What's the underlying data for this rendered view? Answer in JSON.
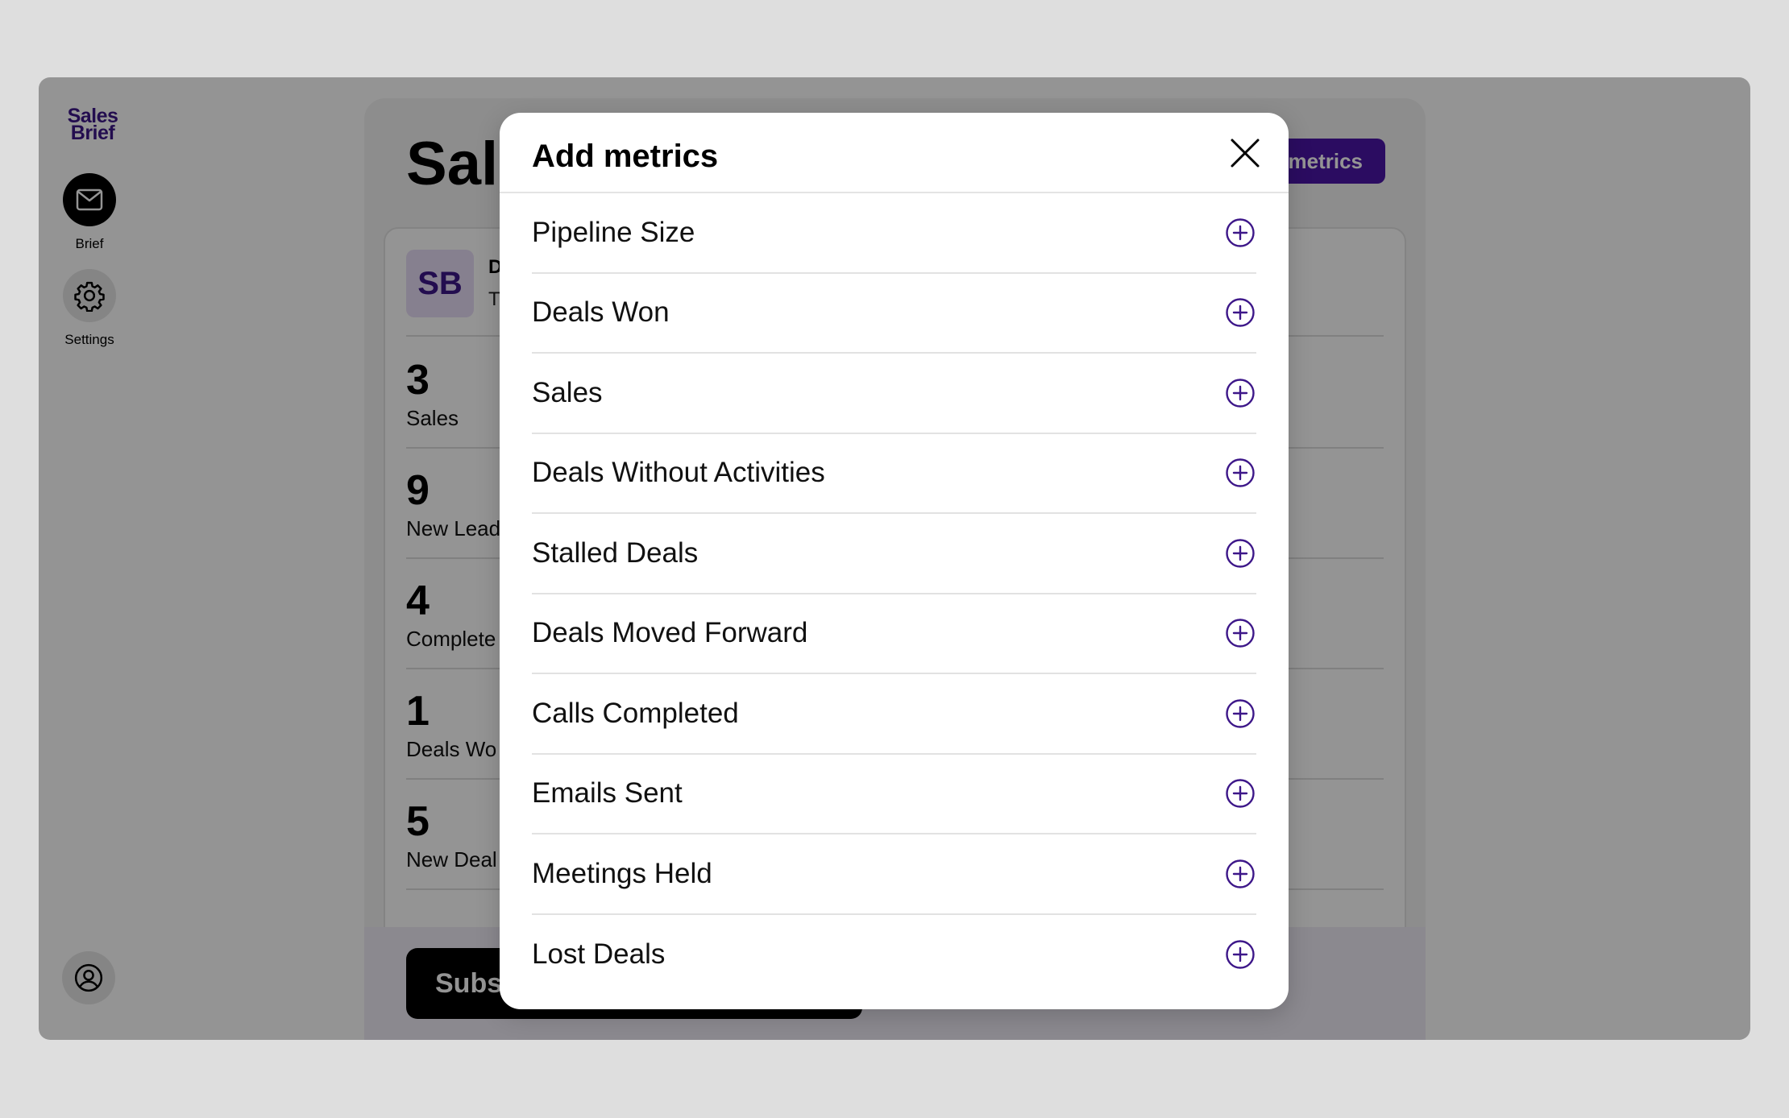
{
  "app": {
    "logo_line1": "Sales",
    "logo_line2": "Brief",
    "nav": {
      "brief_label": "Brief",
      "settings_label": "Settings"
    },
    "icons": {
      "brief": "mail-icon",
      "settings": "gear-icon",
      "profile": "user-circle-icon"
    }
  },
  "background": {
    "title": "Sal",
    "add_metrics_button": "metrics",
    "header": {
      "initials": "SB",
      "name": "D",
      "subtitle": "T"
    },
    "metrics": [
      {
        "value": "3",
        "label": "Sales"
      },
      {
        "value": "9",
        "label": "New Lead"
      },
      {
        "value": "4",
        "label": "Complete"
      },
      {
        "value": "1",
        "label": "Deals Wo"
      },
      {
        "value": "5",
        "label": "New Deal"
      }
    ],
    "subscribe_button": "Subs"
  },
  "modal": {
    "title": "Add metrics",
    "close_icon": "close-icon",
    "items": [
      {
        "label": "Pipeline Size"
      },
      {
        "label": "Deals Won"
      },
      {
        "label": "Sales"
      },
      {
        "label": "Deals Without Activities"
      },
      {
        "label": "Stalled Deals"
      },
      {
        "label": "Deals Moved Forward"
      },
      {
        "label": "Calls Completed"
      },
      {
        "label": "Emails Sent"
      },
      {
        "label": "Meetings Held"
      },
      {
        "label": "Lost Deals"
      }
    ]
  },
  "colors": {
    "brand": "#3d1789",
    "accent_button": "#4b16a7",
    "overlay": "rgba(0,0,0,0.42)"
  }
}
